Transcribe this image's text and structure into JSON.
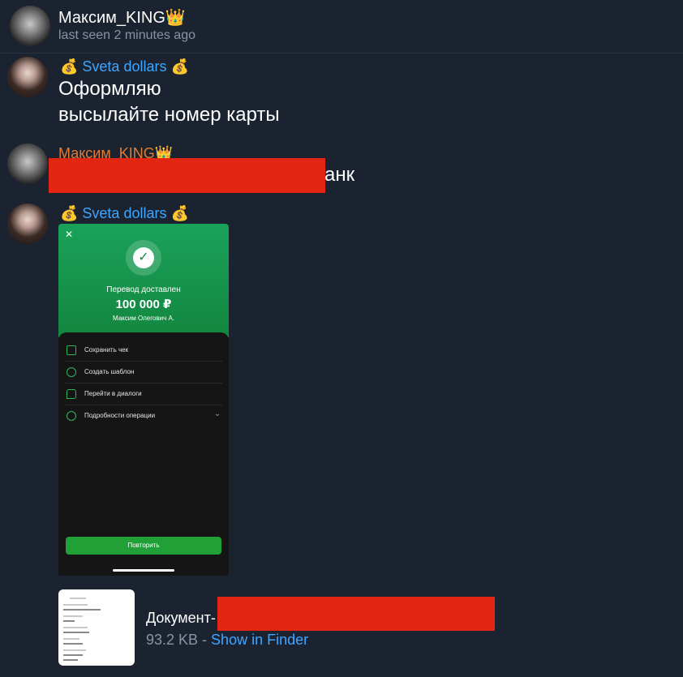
{
  "header": {
    "name": "Максим_KING👑",
    "status": "last seen 2 minutes ago"
  },
  "messages": [
    {
      "sender": "💰 Sveta dollars 💰",
      "lines": [
        "Оформляю",
        "высылайте номер карты"
      ]
    },
    {
      "sender": "Максим_KING👑",
      "text_tail": "анк"
    },
    {
      "sender": "💰 Sveta dollars 💰"
    }
  ],
  "receipt": {
    "close": "✕",
    "status": "Перевод доставлен",
    "amount": "100 000 ₽",
    "recipient": "Максим Олегович А.",
    "menu": [
      {
        "label": "Сохранить чек"
      },
      {
        "label": "Создать шаблон"
      },
      {
        "label": "Перейти в диалоги"
      },
      {
        "label": "Подробности операции"
      }
    ],
    "details_chevron": "⌄",
    "repeat_label": "Повторить"
  },
  "document": {
    "name_prefix": "Документ-",
    "size": "93.2 KB",
    "separator": " - ",
    "show_in_finder": "Show in Finder"
  },
  "colors": {
    "background": "#1b2230",
    "accent_blue": "#3ea6ff",
    "orange_sender": "#e07c35",
    "redaction": "#e32612",
    "sber_green": "#21a038"
  }
}
